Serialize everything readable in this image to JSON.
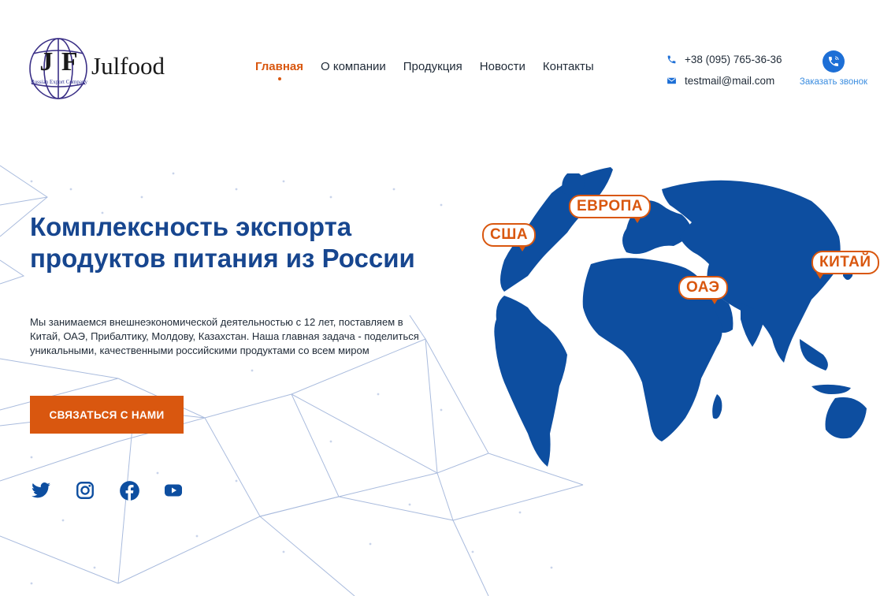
{
  "logo": {
    "monogram": "J F",
    "name": "Julfood",
    "tagline": "Russian Export Company"
  },
  "nav": {
    "items": [
      {
        "label": "Главная",
        "active": true
      },
      {
        "label": "О компании",
        "active": false
      },
      {
        "label": "Продукция",
        "active": false
      },
      {
        "label": "Новости",
        "active": false
      },
      {
        "label": "Контакты",
        "active": false
      }
    ]
  },
  "contacts": {
    "phone": "+38 (095) 765-36-36",
    "email": "testmail@mail.com",
    "callback_label": "Заказать звонок",
    "phone_icon": "phone-icon",
    "email_icon": "mail-icon",
    "callback_icon": "phone-call-icon"
  },
  "hero": {
    "title_line1": "Комплексность экспорта",
    "title_line2": "продуктов питания из России",
    "description": "Мы занимаемся внешнеэкономической деятельностью с 12 лет, поставляем в Китай, ОАЭ, Прибалтику, Молдову, Казахстан. Наша главная задача - поделиться уникальными, качественными российскими продуктами со всем миром",
    "cta_label": "Связаться с нами"
  },
  "socials": [
    {
      "name": "twitter-icon"
    },
    {
      "name": "instagram-icon"
    },
    {
      "name": "facebook-icon"
    },
    {
      "name": "youtube-icon"
    }
  ],
  "map_labels": {
    "usa": "США",
    "europe": "ЕВРОПА",
    "uae": "ОАЭ",
    "china": "КИТАЙ"
  },
  "colors": {
    "brand_blue": "#0d4ea0",
    "accent_orange": "#d9570f",
    "title_blue": "#17468f",
    "link_blue": "#3b8de0"
  }
}
